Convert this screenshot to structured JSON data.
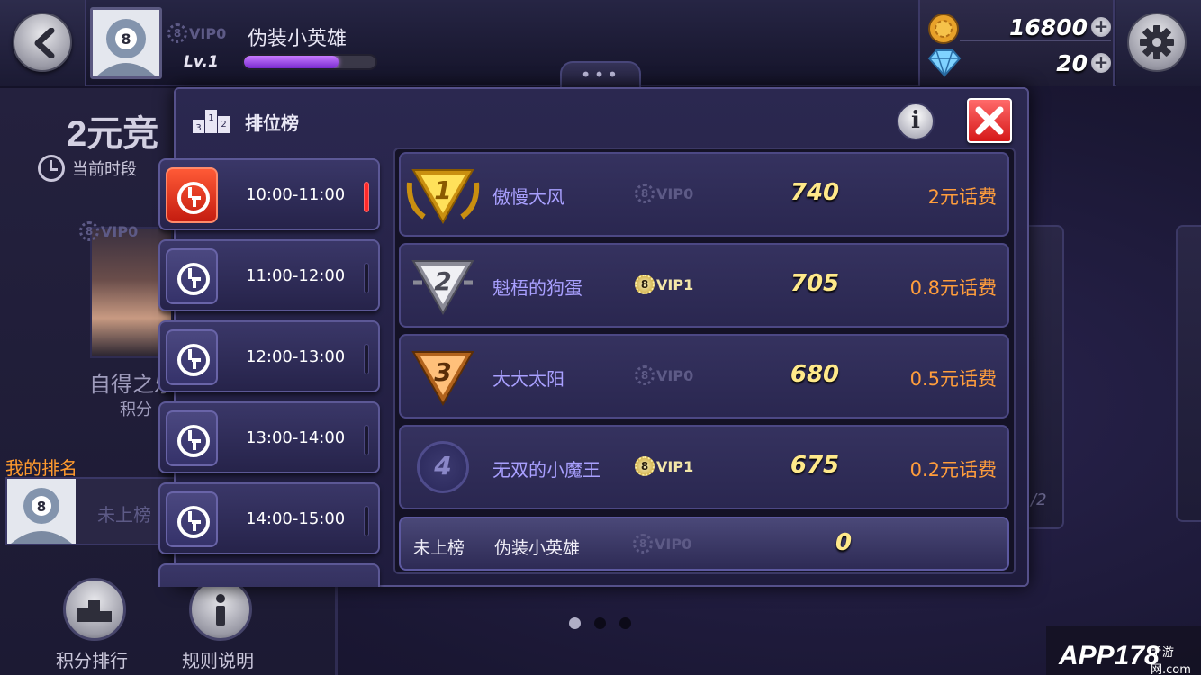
{
  "top_bar": {
    "player_name": "伪装小英雄",
    "vip_label": "VIP0",
    "level": "Lv.1",
    "xp_fraction": 0.72,
    "more_dots": "•••",
    "coins": "16800",
    "diamonds": "20",
    "plus": "+"
  },
  "background": {
    "title": "2元竞",
    "period_label": "当前时段",
    "photo_vip": "VIP0",
    "photo_name": "自得之乐",
    "score_label": "积分",
    "my_rank_label": "我的排名",
    "my_rank_status": "未上榜",
    "leaderboard_button": "积分排行",
    "rules_button": "规则说明",
    "card_text": "/2",
    "watermark": "APP178",
    "watermark_small": "手游网.com"
  },
  "dialog": {
    "title": "排位榜",
    "info_label": "i",
    "time_slots": [
      {
        "label": "10:00-11:00",
        "active": true
      },
      {
        "label": "11:00-12:00",
        "active": false
      },
      {
        "label": "12:00-13:00",
        "active": false
      },
      {
        "label": "13:00-14:00",
        "active": false
      },
      {
        "label": "14:00-15:00",
        "active": false
      }
    ],
    "rankings": [
      {
        "rank": "1",
        "name": "傲慢大风",
        "vip": "VIP0",
        "vip_tier": "grey",
        "score": "740",
        "prize": "2元话费"
      },
      {
        "rank": "2",
        "name": "魁梧的狗蛋",
        "vip": "VIP1",
        "vip_tier": "gold",
        "score": "705",
        "prize": "0.8元话费"
      },
      {
        "rank": "3",
        "name": "大大太阳",
        "vip": "VIP0",
        "vip_tier": "grey",
        "score": "680",
        "prize": "0.5元话费"
      },
      {
        "rank": "4",
        "name": "无双的小魔王",
        "vip": "VIP1",
        "vip_tier": "gold",
        "score": "675",
        "prize": "0.2元话费"
      }
    ],
    "my_row": {
      "status": "未上榜",
      "name": "伪装小英雄",
      "vip": "VIP0",
      "score": "0"
    }
  },
  "colors": {
    "accent_orange": "#ff9d3c",
    "score_yellow": "#ffe98a",
    "name_purple": "#a9a0ff",
    "close_red": "#e02020",
    "active_tab_red": "#e0301c"
  }
}
